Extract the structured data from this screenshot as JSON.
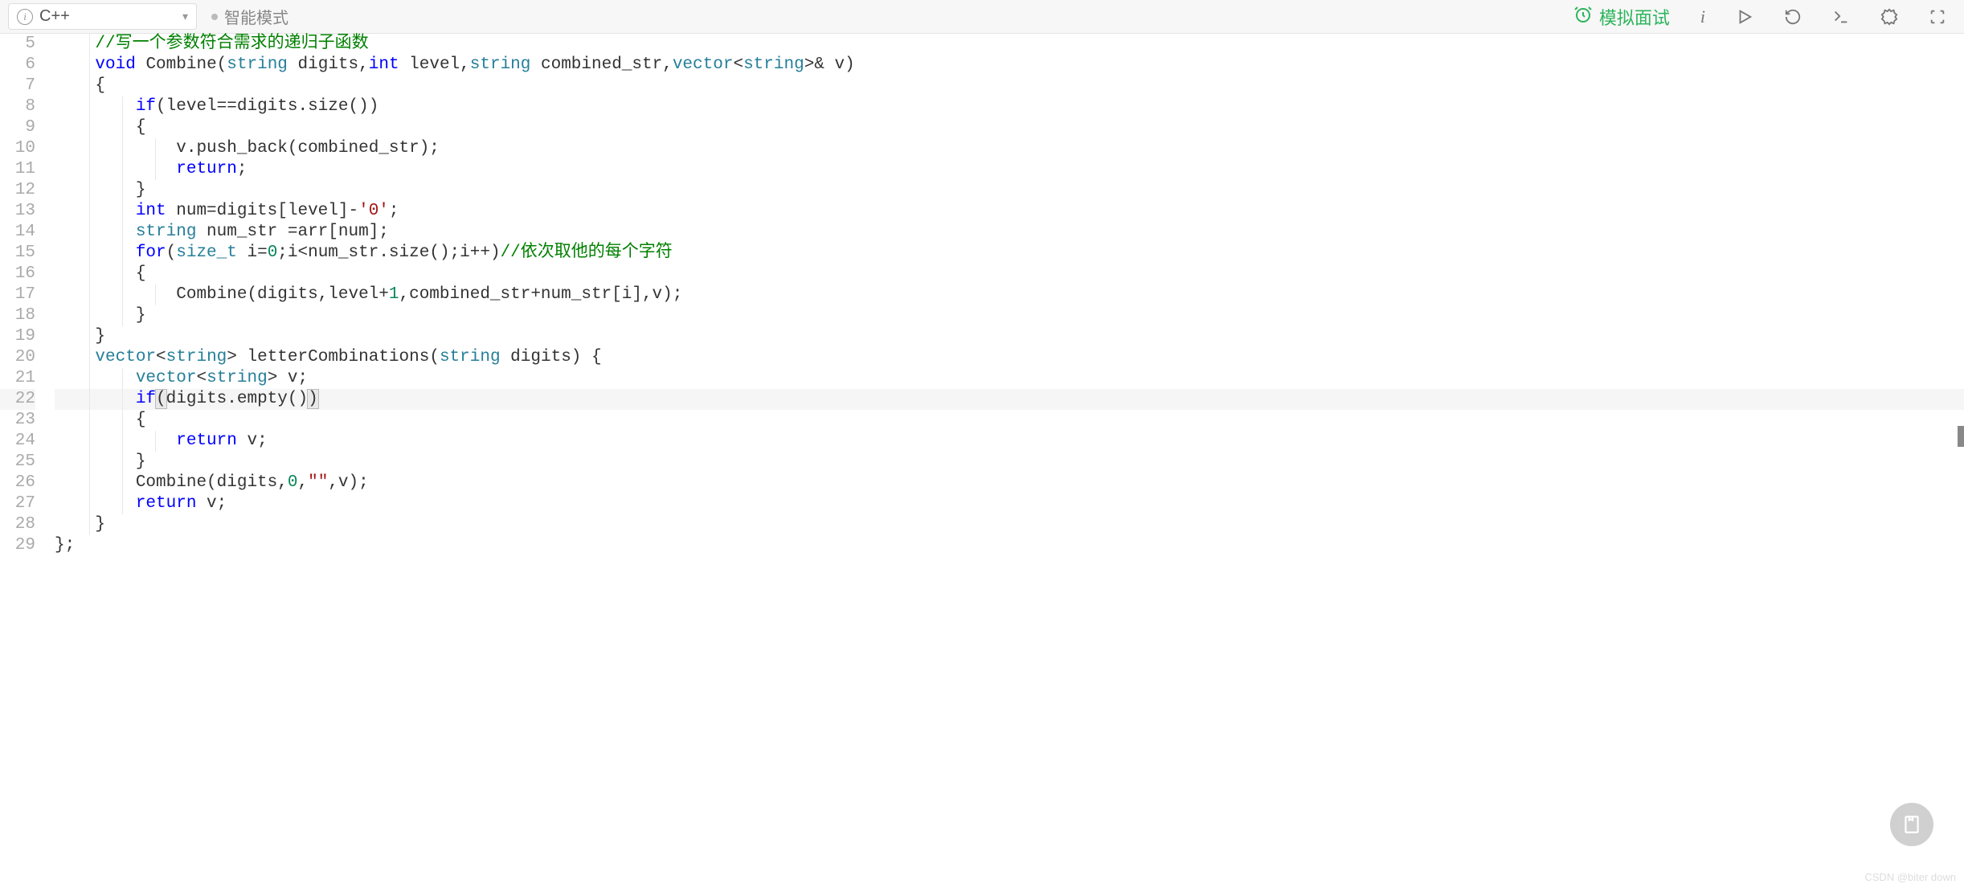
{
  "toolbar": {
    "language": "C++",
    "mode": "智能模式",
    "interview_label": "模拟面试"
  },
  "gutter_start": 5,
  "gutter_end": 29,
  "highlighted_line": 22,
  "code": {
    "lines": [
      {
        "n": 5,
        "indent": 1,
        "tokens": [
          {
            "t": "//写一个参数符合需求的递归子函数",
            "c": "comment"
          }
        ]
      },
      {
        "n": 6,
        "indent": 1,
        "tokens": [
          {
            "t": "void",
            "c": "kw"
          },
          {
            "t": " ",
            "c": ""
          },
          {
            "t": "Combine",
            "c": "fn"
          },
          {
            "t": "(",
            "c": "punct"
          },
          {
            "t": "string",
            "c": "type"
          },
          {
            "t": " digits,",
            "c": "ident"
          },
          {
            "t": "int",
            "c": "kw"
          },
          {
            "t": " level,",
            "c": "ident"
          },
          {
            "t": "string",
            "c": "type"
          },
          {
            "t": " combined_str,",
            "c": "ident"
          },
          {
            "t": "vector",
            "c": "type"
          },
          {
            "t": "<",
            "c": "punct"
          },
          {
            "t": "string",
            "c": "type"
          },
          {
            "t": ">& v)",
            "c": "ident"
          }
        ]
      },
      {
        "n": 7,
        "indent": 1,
        "tokens": [
          {
            "t": "{",
            "c": "punct"
          }
        ]
      },
      {
        "n": 8,
        "indent": 2,
        "tokens": [
          {
            "t": "if",
            "c": "kw"
          },
          {
            "t": "(level==digits.",
            "c": "ident"
          },
          {
            "t": "size",
            "c": "fn"
          },
          {
            "t": "())",
            "c": "punct"
          }
        ]
      },
      {
        "n": 9,
        "indent": 2,
        "tokens": [
          {
            "t": "{",
            "c": "punct"
          }
        ]
      },
      {
        "n": 10,
        "indent": 3,
        "tokens": [
          {
            "t": "v.",
            "c": "ident"
          },
          {
            "t": "push_back",
            "c": "fn"
          },
          {
            "t": "(combined_str);",
            "c": "ident"
          }
        ]
      },
      {
        "n": 11,
        "indent": 3,
        "tokens": [
          {
            "t": "return",
            "c": "kw"
          },
          {
            "t": ";",
            "c": "punct"
          }
        ]
      },
      {
        "n": 12,
        "indent": 2,
        "tokens": [
          {
            "t": "}",
            "c": "punct"
          }
        ]
      },
      {
        "n": 13,
        "indent": 2,
        "tokens": [
          {
            "t": "int",
            "c": "kw"
          },
          {
            "t": " num=digits[level]-",
            "c": "ident"
          },
          {
            "t": "'0'",
            "c": "str"
          },
          {
            "t": ";",
            "c": "punct"
          }
        ]
      },
      {
        "n": 14,
        "indent": 2,
        "tokens": [
          {
            "t": "string",
            "c": "type"
          },
          {
            "t": " num_str =arr[num];",
            "c": "ident"
          }
        ]
      },
      {
        "n": 15,
        "indent": 2,
        "tokens": [
          {
            "t": "for",
            "c": "kw"
          },
          {
            "t": "(",
            "c": "punct"
          },
          {
            "t": "size_t",
            "c": "type"
          },
          {
            "t": " i=",
            "c": "ident"
          },
          {
            "t": "0",
            "c": "num"
          },
          {
            "t": ";i<num_str.",
            "c": "ident"
          },
          {
            "t": "size",
            "c": "fn"
          },
          {
            "t": "();i++)",
            "c": "ident"
          },
          {
            "t": "//依次取他的每个字符",
            "c": "comment"
          }
        ]
      },
      {
        "n": 16,
        "indent": 2,
        "tokens": [
          {
            "t": "{",
            "c": "punct"
          }
        ]
      },
      {
        "n": 17,
        "indent": 3,
        "tokens": [
          {
            "t": "Combine",
            "c": "fn"
          },
          {
            "t": "(digits,level+",
            "c": "ident"
          },
          {
            "t": "1",
            "c": "num"
          },
          {
            "t": ",combined_str+num_str[i],v);",
            "c": "ident"
          }
        ]
      },
      {
        "n": 18,
        "indent": 2,
        "tokens": [
          {
            "t": "}",
            "c": "punct"
          }
        ]
      },
      {
        "n": 19,
        "indent": 1,
        "tokens": [
          {
            "t": "}",
            "c": "punct"
          }
        ]
      },
      {
        "n": 20,
        "indent": 1,
        "tokens": [
          {
            "t": "vector",
            "c": "type"
          },
          {
            "t": "<",
            "c": "punct"
          },
          {
            "t": "string",
            "c": "type"
          },
          {
            "t": "> ",
            "c": "punct"
          },
          {
            "t": "letterCombinations",
            "c": "fn"
          },
          {
            "t": "(",
            "c": "punct"
          },
          {
            "t": "string",
            "c": "type"
          },
          {
            "t": " digits) {",
            "c": "ident"
          }
        ]
      },
      {
        "n": 21,
        "indent": 2,
        "tokens": [
          {
            "t": "vector",
            "c": "type"
          },
          {
            "t": "<",
            "c": "punct"
          },
          {
            "t": "string",
            "c": "type"
          },
          {
            "t": "> v;",
            "c": "ident"
          }
        ]
      },
      {
        "n": 22,
        "indent": 2,
        "highlight": true,
        "tokens": [
          {
            "t": "if",
            "c": "kw"
          },
          {
            "t": "(",
            "c": "punct bracket-match"
          },
          {
            "t": "digits.",
            "c": "ident"
          },
          {
            "t": "empty",
            "c": "fn"
          },
          {
            "t": "()",
            "c": "punct"
          },
          {
            "t": ")",
            "c": "punct bracket-match"
          }
        ]
      },
      {
        "n": 23,
        "indent": 2,
        "tokens": [
          {
            "t": "{",
            "c": "punct"
          }
        ]
      },
      {
        "n": 24,
        "indent": 3,
        "tokens": [
          {
            "t": "return",
            "c": "kw"
          },
          {
            "t": " v;",
            "c": "ident"
          }
        ]
      },
      {
        "n": 25,
        "indent": 2,
        "tokens": [
          {
            "t": "}",
            "c": "punct"
          }
        ]
      },
      {
        "n": 26,
        "indent": 2,
        "tokens": [
          {
            "t": "Combine",
            "c": "fn"
          },
          {
            "t": "(digits,",
            "c": "ident"
          },
          {
            "t": "0",
            "c": "num"
          },
          {
            "t": ",",
            "c": "punct"
          },
          {
            "t": "\"\"",
            "c": "str"
          },
          {
            "t": ",v);",
            "c": "ident"
          }
        ]
      },
      {
        "n": 27,
        "indent": 2,
        "tokens": [
          {
            "t": "return",
            "c": "kw"
          },
          {
            "t": " v;",
            "c": "ident"
          }
        ]
      },
      {
        "n": 28,
        "indent": 1,
        "tokens": [
          {
            "t": "}",
            "c": "punct"
          }
        ]
      },
      {
        "n": 29,
        "indent": 0,
        "tokens": [
          {
            "t": "};",
            "c": "punct"
          }
        ]
      }
    ]
  },
  "watermark": "CSDN @biter down"
}
